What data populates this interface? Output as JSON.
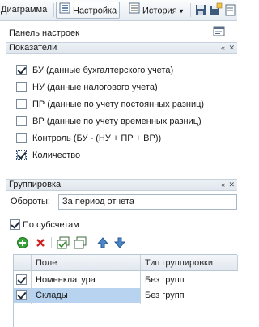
{
  "toolbar": {
    "tab_diagram": "Диаграмма",
    "tab_settings": "Настройка",
    "tab_history": "История",
    "history_arrow": "▾"
  },
  "panel": {
    "title": "Панель настроек"
  },
  "indicators": {
    "header": "Показатели",
    "header_controls": "« ✕",
    "items": [
      {
        "label": "БУ (данные бухгалтерского учета)",
        "checked": true
      },
      {
        "label": "НУ (данные налогового учета)",
        "checked": false
      },
      {
        "label": "ПР (данные по учету постоянных разниц)",
        "checked": false
      },
      {
        "label": "ВР (данные по учету временных разниц)",
        "checked": false
      },
      {
        "label": "Контроль (БУ - (НУ + ПР + ВР))",
        "checked": false
      },
      {
        "label": "Количество",
        "checked": true
      }
    ]
  },
  "grouping": {
    "header": "Группировка",
    "header_controls": "« ✕",
    "turnover_label": "Обороты:",
    "turnover_value": "За период отчета",
    "by_subaccounts_label": "По субсчетам",
    "by_subaccounts_checked": true,
    "table": {
      "columns": [
        "Поле",
        "Тип группировки"
      ],
      "rows": [
        {
          "field": "Номенклатура",
          "type": "Без групп",
          "checked": true,
          "selected": false
        },
        {
          "field": "Склады",
          "type": "Без групп",
          "checked": true,
          "selected": true
        }
      ]
    }
  },
  "colors": {
    "accent": "#b7d3f0",
    "header_bg": "#e6ecf2"
  }
}
